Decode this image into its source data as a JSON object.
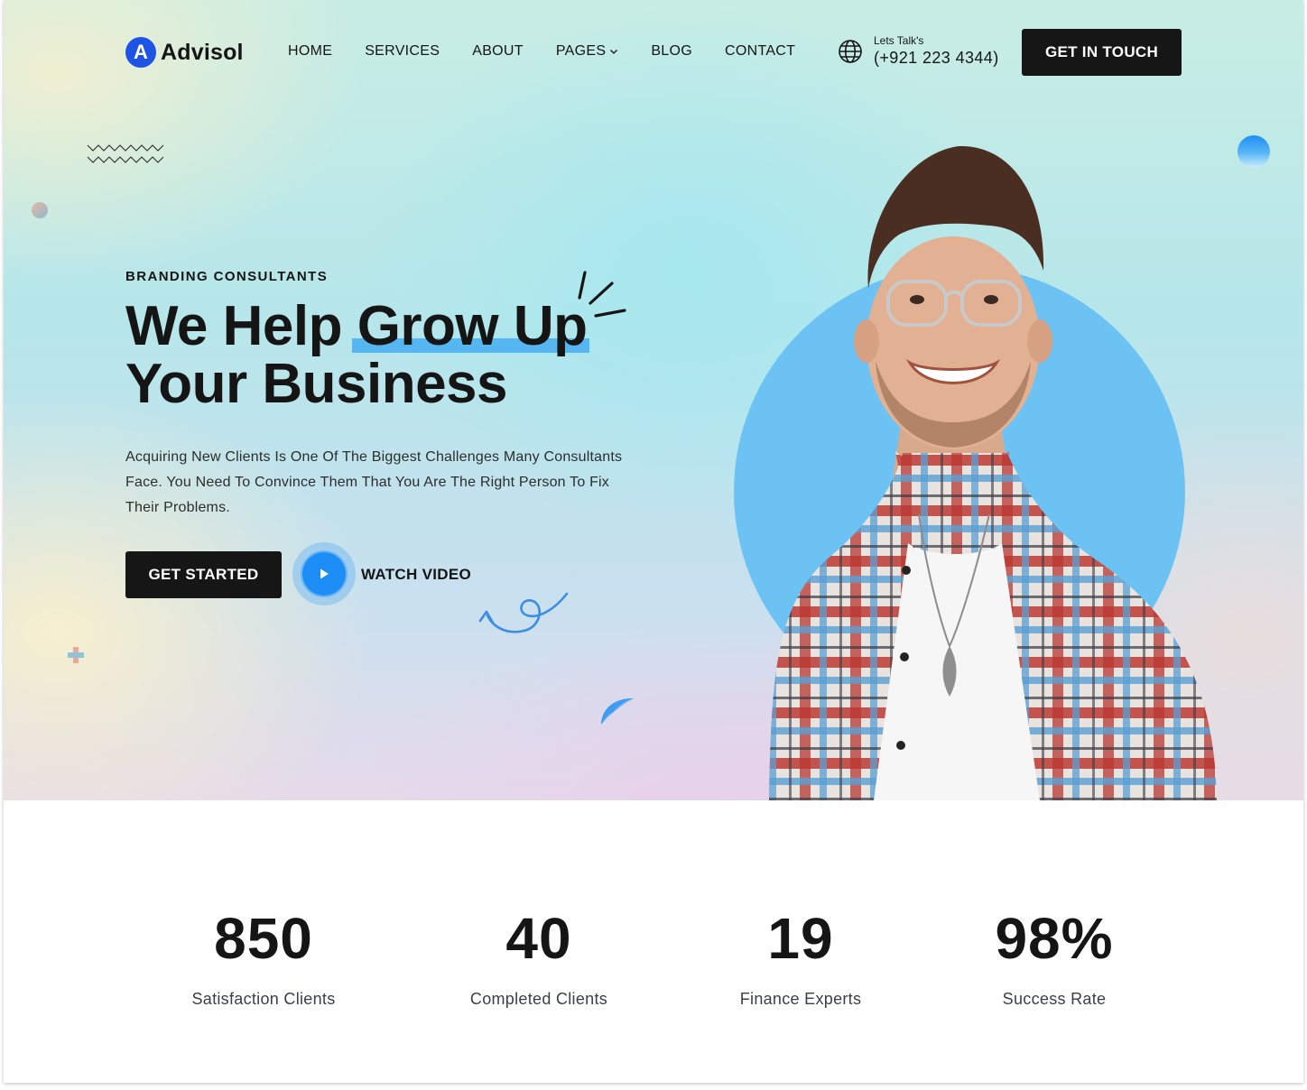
{
  "brand": {
    "logo_letter": "A",
    "name": "Advisol",
    "accent": "#1d54e6"
  },
  "nav": {
    "items": [
      "HOME",
      "SERVICES",
      "ABOUT",
      "PAGES",
      "BLOG",
      "CONTACT"
    ],
    "dropdown_item": "PAGES"
  },
  "contact": {
    "label": "Lets Talk's",
    "phone": "(+921 223 4344)",
    "icon": "globe-icon"
  },
  "header_cta": {
    "label": "GET IN TOUCH"
  },
  "hero": {
    "eyebrow": "BRANDING CONSULTANTS",
    "headline_part1": "We Help ",
    "headline_highlight": "Grow Up",
    "headline_line2": "Your Business",
    "description": "Acquiring New Clients Is One Of The Biggest Challenges Many Consultants Face. You Need To Convince Them That You Are The Right Person To Fix Their Problems.",
    "primary_cta": "GET STARTED",
    "video_cta": "WATCH VIDEO",
    "highlight_color": "#55b6f2",
    "play_color": "#1c8ef5"
  },
  "stats": [
    {
      "value": "850",
      "label": "Satisfaction Clients"
    },
    {
      "value": "40",
      "label": "Completed Clients"
    },
    {
      "value": "19",
      "label": "Finance Experts"
    },
    {
      "value": "98%",
      "label": "Success Rate"
    }
  ]
}
